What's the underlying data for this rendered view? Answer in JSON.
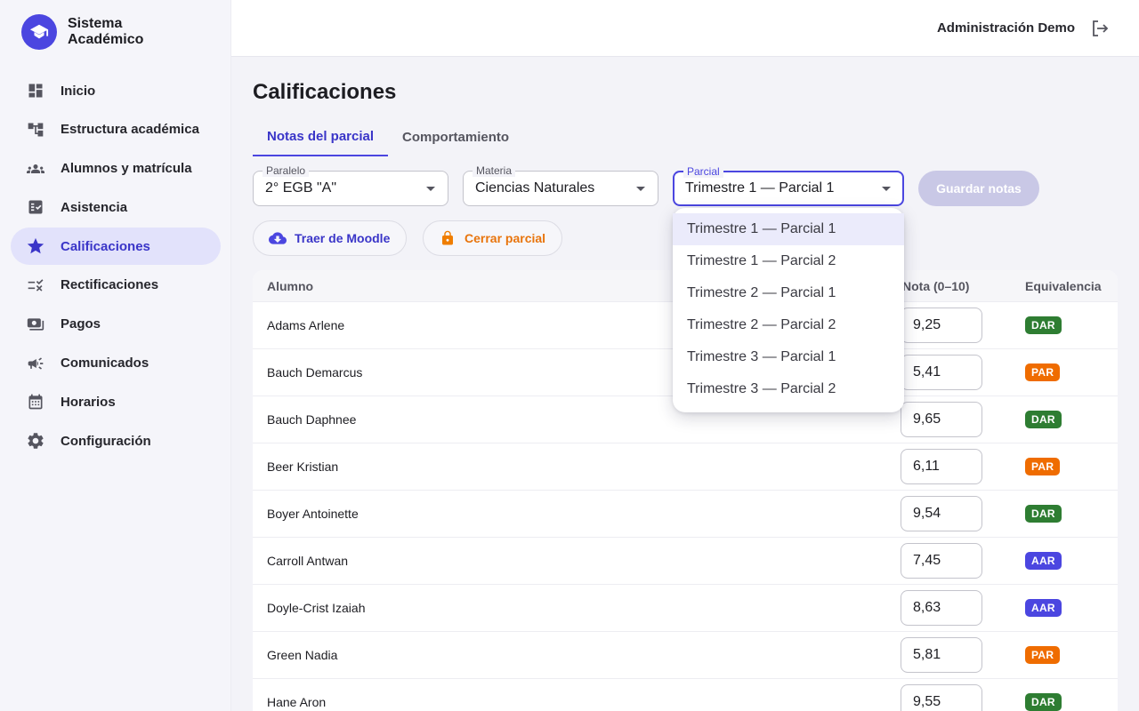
{
  "brand": {
    "line1": "Sistema",
    "line2": "Académico"
  },
  "sidebar": {
    "items": [
      {
        "label": "Inicio",
        "icon": "dashboard-icon"
      },
      {
        "label": "Estructura académica",
        "icon": "tree-icon"
      },
      {
        "label": "Alumnos y matrícula",
        "icon": "people-icon"
      },
      {
        "label": "Asistencia",
        "icon": "checklist-icon"
      },
      {
        "label": "Calificaciones",
        "icon": "star-icon",
        "active": true
      },
      {
        "label": "Rectificaciones",
        "icon": "rule-icon"
      },
      {
        "label": "Pagos",
        "icon": "payments-icon"
      },
      {
        "label": "Comunicados",
        "icon": "megaphone-icon"
      },
      {
        "label": "Horarios",
        "icon": "calendar-icon"
      },
      {
        "label": "Configuración",
        "icon": "gear-icon"
      }
    ]
  },
  "topbar": {
    "user": "Administración Demo"
  },
  "page": {
    "title": "Calificaciones"
  },
  "tabs": [
    {
      "label": "Notas del parcial",
      "active": true
    },
    {
      "label": "Comportamiento",
      "active": false
    }
  ],
  "filters": {
    "paralelo": {
      "label": "Paralelo",
      "value": "2° EGB \"A\""
    },
    "materia": {
      "label": "Materia",
      "value": "Ciencias Naturales"
    },
    "parcial": {
      "label": "Parcial",
      "value": "Trimestre 1 — Parcial 1"
    }
  },
  "actions": {
    "save": "Guardar notas",
    "moodle": "Traer de Moodle",
    "close": "Cerrar parcial"
  },
  "table": {
    "headers": {
      "student": "Alumno",
      "grade": "Nota (0–10)",
      "equiv": "Equivalencia"
    },
    "rows": [
      {
        "name": "Adams Arlene",
        "grade": "9,25",
        "equiv": "DAR"
      },
      {
        "name": "Bauch Demarcus",
        "grade": "5,41",
        "equiv": "PAR"
      },
      {
        "name": "Bauch Daphnee",
        "grade": "9,65",
        "equiv": "DAR"
      },
      {
        "name": "Beer Kristian",
        "grade": "6,11",
        "equiv": "PAR"
      },
      {
        "name": "Boyer Antoinette",
        "grade": "9,54",
        "equiv": "DAR"
      },
      {
        "name": "Carroll Antwan",
        "grade": "7,45",
        "equiv": "AAR"
      },
      {
        "name": "Doyle-Crist Izaiah",
        "grade": "8,63",
        "equiv": "AAR"
      },
      {
        "name": "Green Nadia",
        "grade": "5,81",
        "equiv": "PAR"
      },
      {
        "name": "Hane Aron",
        "grade": "9,55",
        "equiv": "DAR"
      }
    ]
  },
  "equiv_colors": {
    "DAR": "#2e7d32",
    "PAR": "#ef6c00",
    "AAR": "#4b46e0"
  },
  "dropdown": {
    "options": [
      "Trimestre 1 — Parcial 1",
      "Trimestre 1 — Parcial 2",
      "Trimestre 2 — Parcial 1",
      "Trimestre 2 — Parcial 2",
      "Trimestre 3 — Parcial 1",
      "Trimestre 3 — Parcial 2"
    ],
    "selected": 0
  }
}
